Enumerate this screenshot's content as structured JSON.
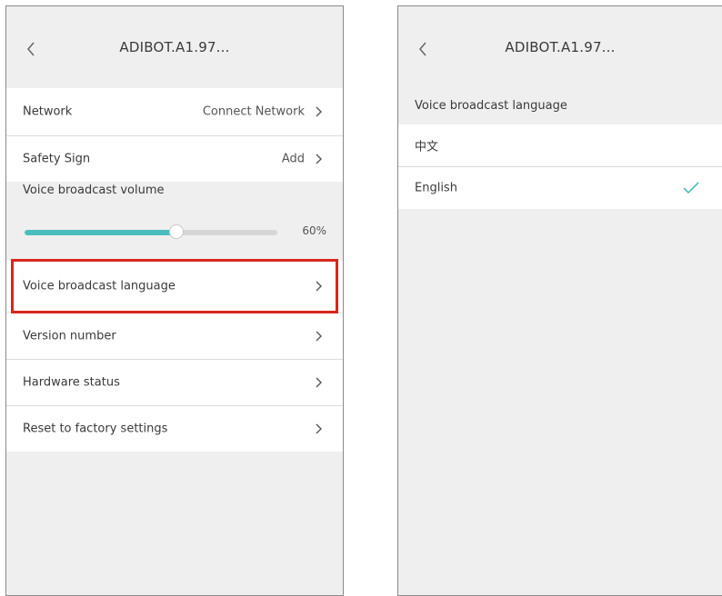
{
  "left_screen": {
    "nav": {
      "title": "ADIBOT.A1.97..."
    },
    "rows": {
      "network": {
        "label": "Network",
        "value": "Connect Network"
      },
      "safety_sign": {
        "label": "Safety Sign",
        "value": "Add"
      },
      "volume_label": "Voice broadcast volume",
      "volume": {
        "percent": 60,
        "text": "60%"
      },
      "language": {
        "label": "Voice broadcast language"
      },
      "version": {
        "label": "Version number"
      },
      "hardware": {
        "label": "Hardware status"
      },
      "reset": {
        "label": "Reset to factory settings"
      }
    }
  },
  "right_screen": {
    "nav": {
      "title": "ADIBOT.A1.97..."
    },
    "section_label": "Voice broadcast language",
    "options": [
      {
        "label": "中文",
        "selected": false
      },
      {
        "label": "English",
        "selected": true
      }
    ]
  },
  "colors": {
    "accent": "#4cbdbd",
    "highlight": "#d9261c",
    "background": "#efefef",
    "row": "#ffffff"
  }
}
